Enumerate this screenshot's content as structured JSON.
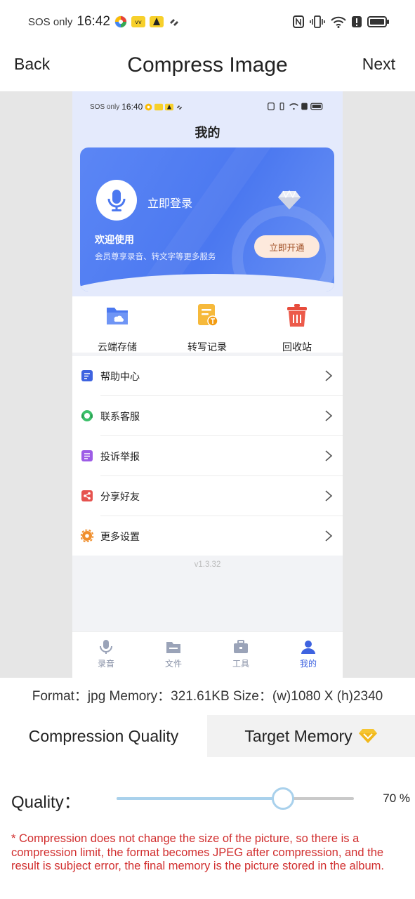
{
  "status_bar": {
    "carrier": "SOS only",
    "time": "16:42"
  },
  "header": {
    "back_label": "Back",
    "title": "Compress Image",
    "next_label": "Next"
  },
  "preview": {
    "status_bar": {
      "carrier": "SOS only",
      "time": "16:40"
    },
    "title": "我的",
    "card": {
      "login_label": "立即登录",
      "welcome": "欢迎使用",
      "description": "会员尊享录音、转文字等更多服务",
      "vip_button": "立即开通"
    },
    "quick_items": [
      {
        "label": "云端存储",
        "icon": "cloud-folder-icon"
      },
      {
        "label": "转写记录",
        "icon": "transcript-icon"
      },
      {
        "label": "回收站",
        "icon": "trash-icon"
      }
    ],
    "menu_items": [
      {
        "label": "帮助中心",
        "icon": "help-icon",
        "color": "#3e63e0"
      },
      {
        "label": "联系客服",
        "icon": "headset-icon",
        "color": "#3cc06a"
      },
      {
        "label": "投诉举报",
        "icon": "complaint-icon",
        "color": "#9d5ce6"
      },
      {
        "label": "分享好友",
        "icon": "share-icon",
        "color": "#e6534f"
      },
      {
        "label": "更多设置",
        "icon": "settings-icon",
        "color": "#f08f2e"
      }
    ],
    "version": "v1.3.32",
    "tabs": [
      {
        "label": "录音",
        "icon": "mic-icon",
        "active": false
      },
      {
        "label": "文件",
        "icon": "folder-icon",
        "active": false
      },
      {
        "label": "工具",
        "icon": "toolbox-icon",
        "active": false
      },
      {
        "label": "我的",
        "icon": "person-icon",
        "active": true
      }
    ]
  },
  "image_info": "Format：jpg Memory：321.61KB Size：(w)1080 X (h)2340",
  "mode_tabs": {
    "quality_label": "Compression Quality",
    "memory_label": "Target Memory",
    "memory_badge_icon": "premium-diamond-icon"
  },
  "quality": {
    "label": "Quality：",
    "value_text": "70 %",
    "level_percent": 70
  },
  "note": "* Compression does not change the size of the picture, so there is a compression limit, the format becomes JPEG after compression, and the result is subject error, the final memory is the picture stored in the album.",
  "colors": {
    "accent": "#4b78f0",
    "slider": "#a9d1ec",
    "warning_text": "#d12e2e",
    "premium": "#f5c531"
  }
}
